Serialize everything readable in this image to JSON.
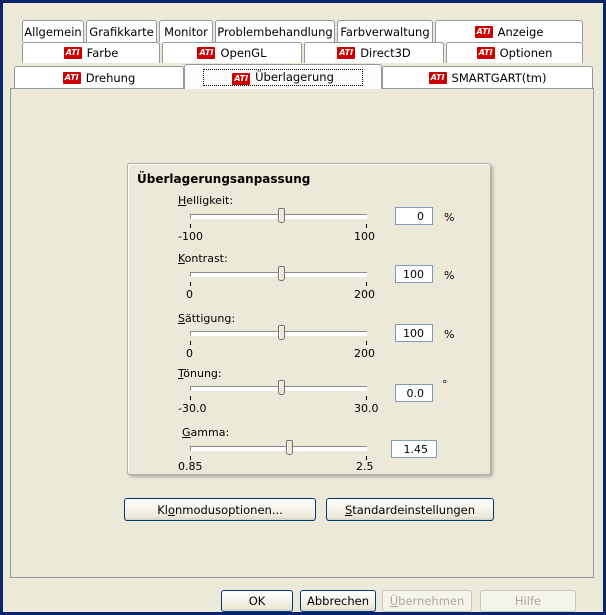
{
  "tabs_row1": [
    {
      "label": "Allgemein",
      "ati": false
    },
    {
      "label": "Grafikkarte",
      "ati": false
    },
    {
      "label": "Monitor",
      "ati": false
    },
    {
      "label": "Problembehandlung",
      "ati": false
    },
    {
      "label": "Farbverwaltung",
      "ati": false
    },
    {
      "label": "Anzeige",
      "ati": true
    }
  ],
  "tabs_row2": [
    {
      "label": "Farbe",
      "ati": true
    },
    {
      "label": "OpenGL",
      "ati": true
    },
    {
      "label": "Direct3D",
      "ati": true
    },
    {
      "label": "Optionen",
      "ati": true
    }
  ],
  "tabs_row3": [
    {
      "label": "Drehung",
      "ati": true
    },
    {
      "label": "Überlagerung",
      "ati": true,
      "active": true
    },
    {
      "label": "SMARTGART(tm)",
      "ati": true
    }
  ],
  "ati_badge": "ATI",
  "group": {
    "title": "Überlagerungsanpassung",
    "sliders": [
      {
        "label_u": "H",
        "label_rest": "elligkeit:",
        "min": "-100",
        "max": "100",
        "value": "0",
        "unit": "%",
        "level": 0.5
      },
      {
        "label_u": "K",
        "label_rest": "ontrast:",
        "min": "0",
        "max": "200",
        "value": "100",
        "unit": "%",
        "level": 0.5
      },
      {
        "label_u": "S",
        "label_rest": "ättigung:",
        "min": "0",
        "max": "200",
        "value": "100",
        "unit": "%",
        "level": 0.5
      },
      {
        "label_u": "T",
        "label_rest": "önung:",
        "min": "-30.0",
        "max": "30.0",
        "value": "0.0",
        "unit": "°",
        "level": 0.5
      },
      {
        "label_u": "G",
        "label_rest": "amma:",
        "min": "0.85",
        "max": "2.5",
        "value": "1.45",
        "unit": "",
        "level": 0.55
      }
    ]
  },
  "buttons": {
    "clone_u": "o",
    "clone_pre": "Kl",
    "clone_post": "nmodusoptionen...",
    "defaults_u": "S",
    "defaults_rest": "tandardeinstellungen",
    "ok": "OK",
    "cancel": "Abbrechen",
    "apply_u": "Ü",
    "apply_rest": "bernehmen",
    "help": "Hilfe"
  },
  "colors": {
    "accent": "#0a246a",
    "ati_red": "#cc0000",
    "tab_border": "#919b9c"
  }
}
